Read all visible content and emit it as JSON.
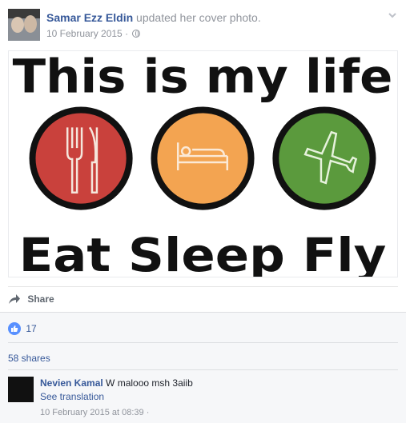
{
  "post": {
    "author": "Samar Ezz Eldin",
    "action": "updated her cover photo.",
    "date": "10 February 2015",
    "separator": "·",
    "privacy_icon": "globe-icon",
    "menu_icon": "chevron-down-icon"
  },
  "cover": {
    "line1": "This is my life",
    "line2": "Eat Sleep Fly",
    "circles": [
      {
        "icon": "fork-knife-icon",
        "color": "#c9413c"
      },
      {
        "icon": "bed-icon",
        "color": "#f3a451"
      },
      {
        "icon": "airplane-icon",
        "color": "#5b9a3d"
      }
    ]
  },
  "actions": {
    "share_label": "Share"
  },
  "stats": {
    "likes_count": "17",
    "shares_label": "58 shares"
  },
  "comment": {
    "author": "Nevien Kamal",
    "text": "W malooo msh 3aiib",
    "translation_link": "See translation",
    "timestamp": "10 February 2015 at 08:39 ·"
  },
  "colors": {
    "link": "#365899",
    "muted": "#90949c",
    "like_blue": "#5890ff"
  }
}
